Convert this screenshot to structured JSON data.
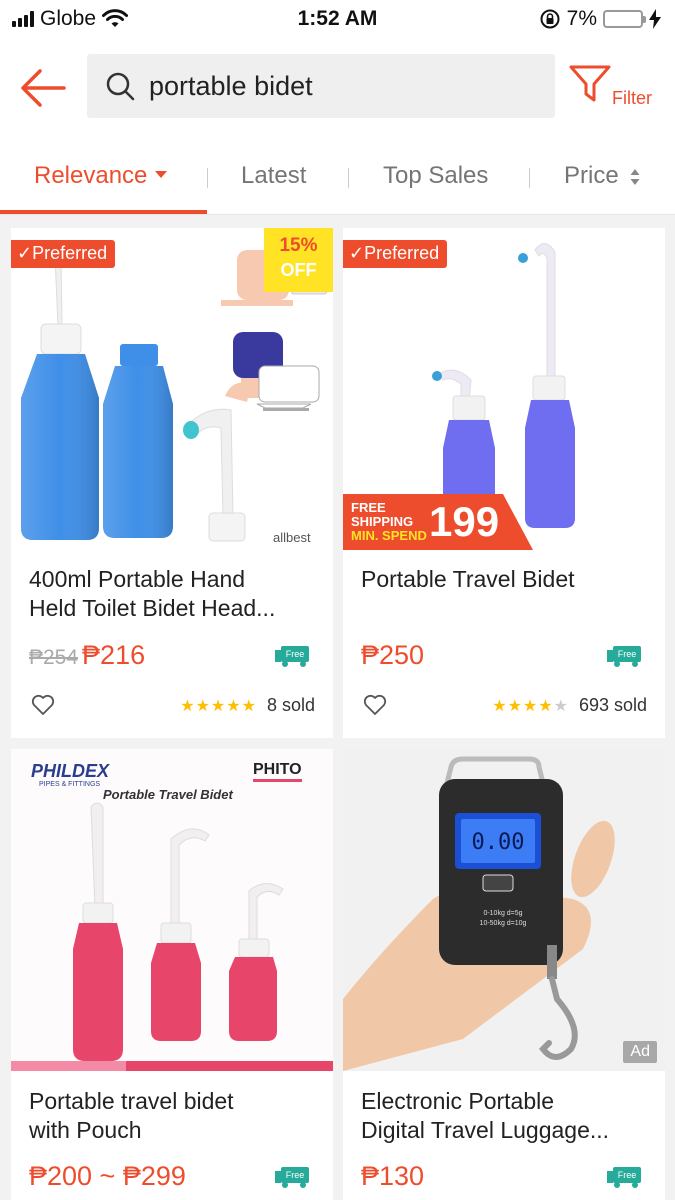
{
  "status_bar": {
    "carrier": "Globe",
    "time": "1:52 AM",
    "battery_percent": "7%",
    "battery_level": 0.07
  },
  "header": {
    "search_query": "portable bidet",
    "filter_label": "Filter"
  },
  "sort_tabs": [
    {
      "label": "Relevance",
      "active": true
    },
    {
      "label": "Latest",
      "active": false
    },
    {
      "label": "Top Sales",
      "active": false
    },
    {
      "label": "Price",
      "active": false
    }
  ],
  "products": [
    {
      "badge": "Preferred",
      "title_line1": "400ml Portable Hand",
      "title_line2": "Held Toilet Bidet Head...",
      "old_price": "₱254",
      "price": "₱216",
      "free_shipping_label": "Free",
      "rating": 5,
      "sold": "8 sold",
      "discount_percent": "15%",
      "discount_off": "OFF",
      "brand_mark": "allbest"
    },
    {
      "badge": "Preferred",
      "title_line1": "Portable Travel Bidet",
      "title_line2": "",
      "price": "₱250",
      "free_shipping_label": "Free",
      "rating": 4.5,
      "sold": "693 sold",
      "promo_line1": "FREE",
      "promo_line2": "SHIPPING",
      "promo_line3": "MIN. SPEND",
      "promo_amount": "199"
    },
    {
      "title_line1": "Portable travel bidet",
      "title_line2": "with Pouch",
      "price": "₱200 ~ ₱299",
      "free_shipping_label": "Free",
      "brand_left": "PHILDEX",
      "brand_left_sub": "PIPES & FITTINGS",
      "brand_right": "PHITO",
      "image_caption": "Portable Travel Bidet"
    },
    {
      "title_line1": "Electronic Portable",
      "title_line2": "Digital Travel Luggage...",
      "price": "₱130",
      "free_shipping_label": "Free",
      "ad_label": "Ad",
      "scale_display": "0.00",
      "scale_spec1": "0-10kg d=5g",
      "scale_spec2": "10-50kg d=10g"
    }
  ],
  "colors": {
    "accent": "#ee4d2d",
    "star": "#ffbf00",
    "free_ship": "#26aa99"
  }
}
